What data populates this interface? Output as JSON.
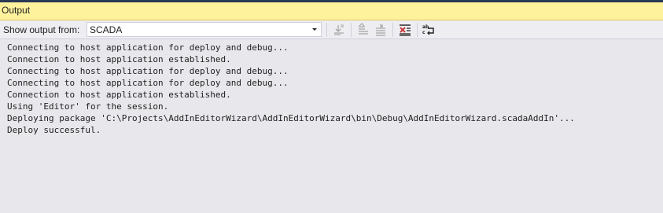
{
  "panel": {
    "title": "Output"
  },
  "toolbar": {
    "show_output_label": "Show output from:",
    "source_selected": "SCADA",
    "buttons": [
      {
        "icon": "go-to-line-icon",
        "enabled": false
      },
      {
        "icon": "previous-message-icon",
        "enabled": false
      },
      {
        "icon": "next-message-icon",
        "enabled": false
      },
      {
        "icon": "clear-all-icon",
        "enabled": true
      },
      {
        "icon": "word-wrap-icon",
        "enabled": true
      }
    ]
  },
  "output": {
    "lines": [
      "Connecting to host application for deploy and debug...",
      "Connection to host application established.",
      "Connecting to host application for deploy and debug...",
      "Connecting to host application for deploy and debug...",
      "Connection to host application established.",
      "Using 'Editor' for the session.",
      "Deploying package 'C:\\Projects\\AddInEditorWizard\\AddInEditorWizard\\bin\\Debug\\AddInEditorWizard.scadaAddIn'...",
      "Deploy successful."
    ]
  },
  "colors": {
    "title_bar_bg": "#fff29d",
    "top_strip": "#293955",
    "toolbar_bg": "#eeeef2",
    "output_bg": "#e8e8ec",
    "clear_icon_red": "#c83a3a"
  }
}
